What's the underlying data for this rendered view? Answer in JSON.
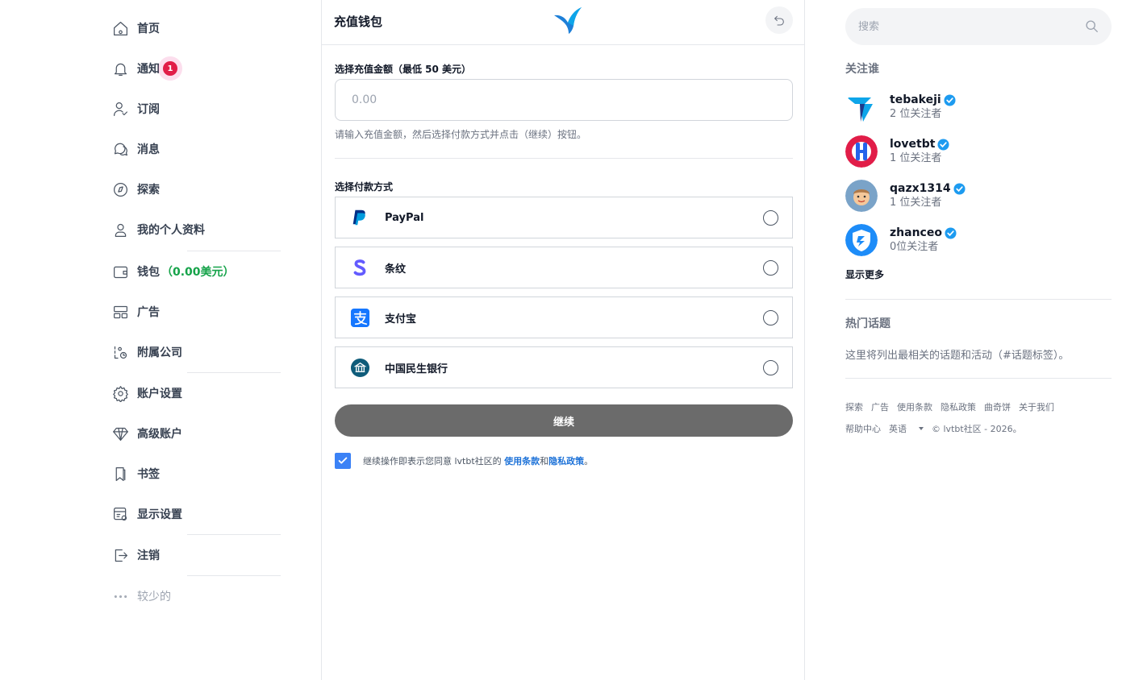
{
  "sidebar": {
    "items": [
      {
        "label": "首页"
      },
      {
        "label": "通知",
        "badge": "1"
      },
      {
        "label": "订阅"
      },
      {
        "label": "消息"
      },
      {
        "label": "探索"
      },
      {
        "label": "我的个人资料"
      },
      {
        "label": "钱包",
        "amount": "（0.00美元）"
      },
      {
        "label": "广告"
      },
      {
        "label": "附属公司"
      },
      {
        "label": "账户设置"
      },
      {
        "label": "高级账户"
      },
      {
        "label": "书签"
      },
      {
        "label": "显示设置"
      },
      {
        "label": "注销"
      },
      {
        "label": "较少的"
      }
    ]
  },
  "wallet": {
    "title": "充值钱包",
    "amount_label": "选择充值金额（最低 50 美元）",
    "amount_placeholder": "0.00",
    "amount_hint": "请输入充值金额，然后选择付款方式并点击（继续）按钮。",
    "payment_label": "选择付款方式",
    "methods": [
      {
        "name": "PayPal"
      },
      {
        "name": "条纹"
      },
      {
        "name": "支付宝"
      },
      {
        "name": "中国民生银行"
      }
    ],
    "continue_label": "继续",
    "agree_prefix": "继续操作即表示您同意 lvtbt社区的 ",
    "terms_link": "使用条款",
    "and": "和",
    "privacy_link": "隐私政策",
    "agree_suffix": "。"
  },
  "right": {
    "search_placeholder": "搜索",
    "who_to_follow": "关注谁",
    "users": [
      {
        "name": "tebakeji",
        "followers": "2 位关注者"
      },
      {
        "name": "lovetbt",
        "followers": "1 位关注者"
      },
      {
        "name": "qazx1314",
        "followers": "1 位关注者"
      },
      {
        "name": "zhanceo",
        "followers": "0位关注者"
      }
    ],
    "show_more": "显示更多",
    "trending_title": "热门话题",
    "trending_text": "这里将列出最相关的话题和活动（#话题标签）。",
    "footer_row1": [
      "探索",
      "广告",
      "使用条款",
      "隐私政策",
      "曲奇饼",
      "关于我们"
    ],
    "footer_help": "帮助中心",
    "footer_lang": "英语",
    "footer_copy": "© lvtbt社区 - 2026。"
  },
  "colors": {
    "accent": "#3b82f6",
    "wallet_amount": "#16a34a",
    "badge": "#e11d48",
    "continue_button": "#6b6b6b"
  }
}
